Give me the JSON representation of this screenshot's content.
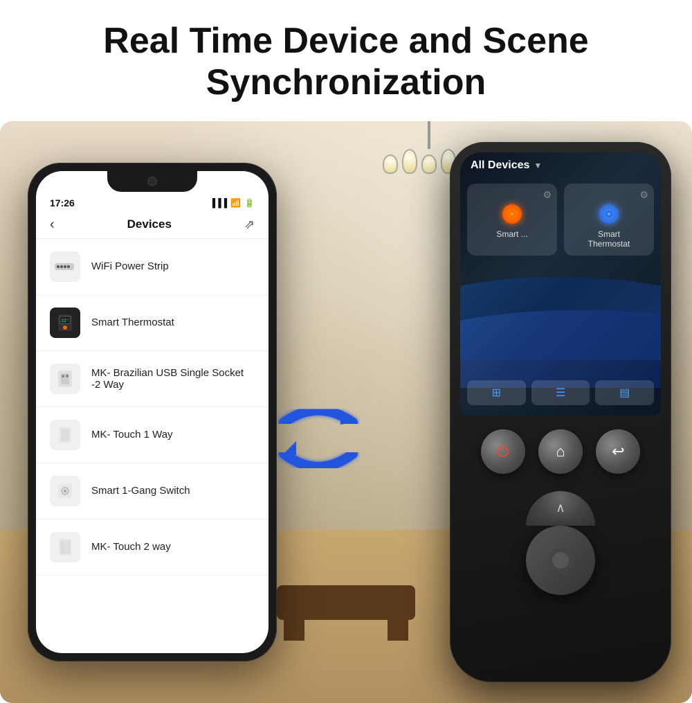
{
  "header": {
    "title_line1": "Real Time Device and Scene",
    "title_line2": "Synchronization"
  },
  "phone": {
    "status_time": "17:26",
    "nav_title": "Devices",
    "devices": [
      {
        "id": "wifi-power-strip",
        "name": "WiFi Power Strip",
        "icon": "🔌",
        "dark": false
      },
      {
        "id": "smart-thermostat",
        "name": "Smart Thermostat",
        "icon": "🌡",
        "dark": true
      },
      {
        "id": "mk-brazilian",
        "name": "MK- Brazilian USB Single Socket -2 Way",
        "icon": "🔌",
        "dark": false
      },
      {
        "id": "mk-touch-1",
        "name": "MK- Touch 1 Way",
        "icon": "💡",
        "dark": false
      },
      {
        "id": "smart-1gang",
        "name": "Smart 1-Gang Switch",
        "icon": "🔘",
        "dark": false
      },
      {
        "id": "mk-touch-2",
        "name": "MK- Touch 2 way",
        "icon": "💡",
        "dark": false
      }
    ]
  },
  "remote": {
    "header": "All Devices",
    "cards": [
      {
        "id": "card-smart-plug",
        "label": "Smart ...",
        "dot_color": "orange"
      },
      {
        "id": "card-smart-thermostat",
        "label": "Smart\nThermostat",
        "dot_color": "blue"
      }
    ],
    "tabs": [
      "grid",
      "list",
      "menu"
    ],
    "buttons": [
      {
        "id": "power-btn",
        "icon": "⏻",
        "type": "power"
      },
      {
        "id": "home-btn",
        "icon": "⌂",
        "type": "home"
      },
      {
        "id": "back-btn",
        "icon": "↩",
        "type": "back"
      }
    ],
    "dpad_up": "∧"
  },
  "sync_icon": "↻"
}
